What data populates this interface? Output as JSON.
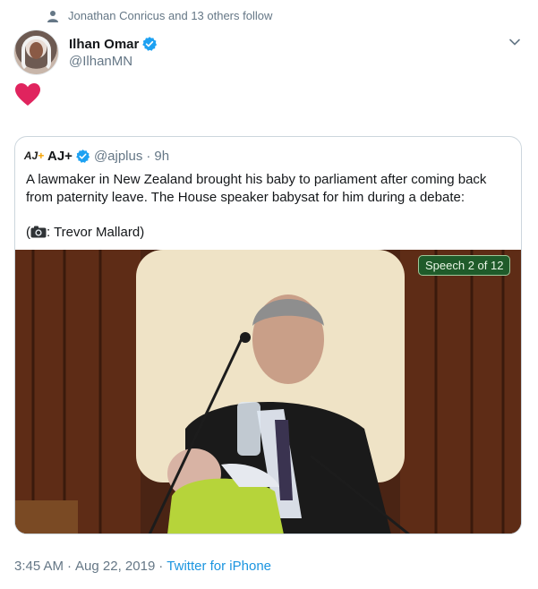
{
  "social_context": {
    "text": "Jonathan Conricus and 13 others follow"
  },
  "author": {
    "name": "Ilhan Omar",
    "handle": "@IlhanMN",
    "verified": true
  },
  "tweet": {
    "body_icon": "red-heart-emoji"
  },
  "quoted_tweet": {
    "name": "AJ+",
    "handle": "@ajplus",
    "separator": "·",
    "time": "9h",
    "text": "A lawmaker in New Zealand brought his baby to parliament after coming back from paternity leave. The House speaker babysat for him during a debate:",
    "credit_prefix": "(",
    "credit_name": ": Trevor Mallard)",
    "media_badge": "Speech 2 of 12"
  },
  "footer": {
    "time": "3:45 AM",
    "separator1": "·",
    "date": "Aug 22, 2019",
    "separator2": "·",
    "source": "Twitter for iPhone"
  },
  "colors": {
    "link": "#1b95e0",
    "muted": "#657786",
    "heart": "#e0245e",
    "border": "#ccd6dd"
  }
}
